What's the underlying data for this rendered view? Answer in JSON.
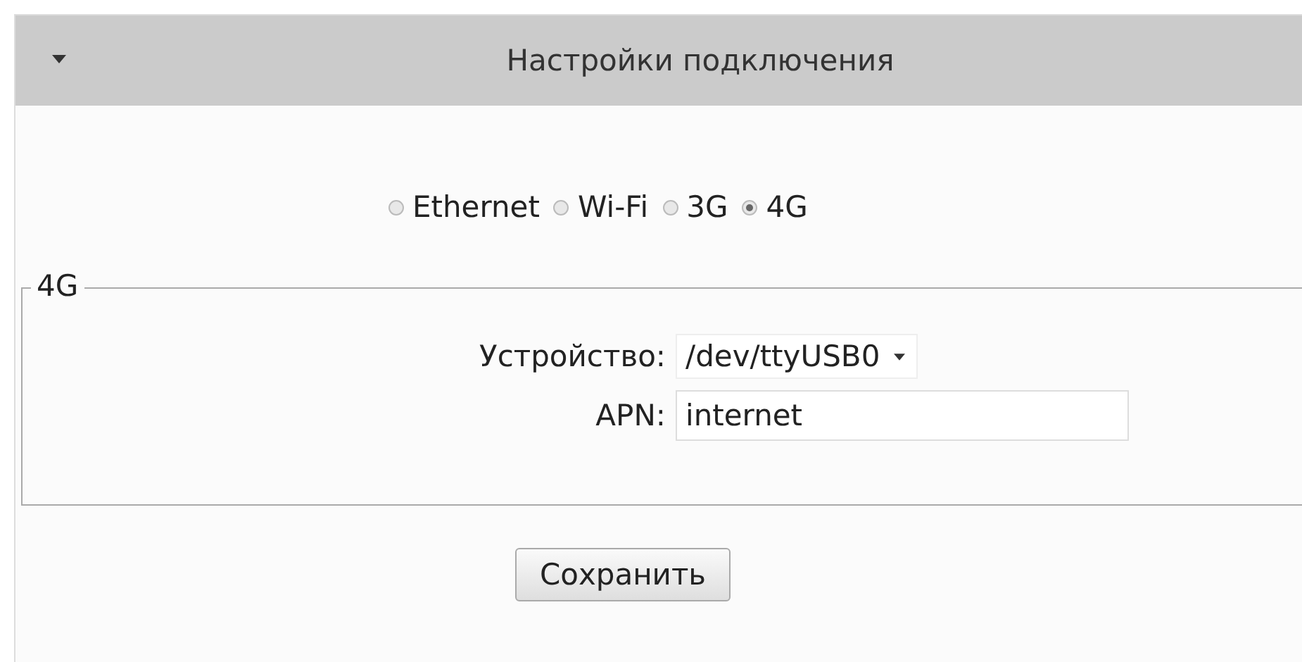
{
  "panel": {
    "title": "Настройки подключения",
    "expanded": true
  },
  "connection_types": [
    {
      "label": "Ethernet",
      "selected": false
    },
    {
      "label": "Wi-Fi",
      "selected": false
    },
    {
      "label": "3G",
      "selected": false
    },
    {
      "label": "4G",
      "selected": true
    }
  ],
  "fieldset": {
    "legend": "4G",
    "fields": [
      {
        "kind": "select",
        "label": "Устройство:",
        "value": "/dev/ttyUSB0"
      },
      {
        "kind": "text",
        "label": "APN:",
        "value": "internet"
      }
    ]
  },
  "buttons": [
    "Сохранить"
  ]
}
